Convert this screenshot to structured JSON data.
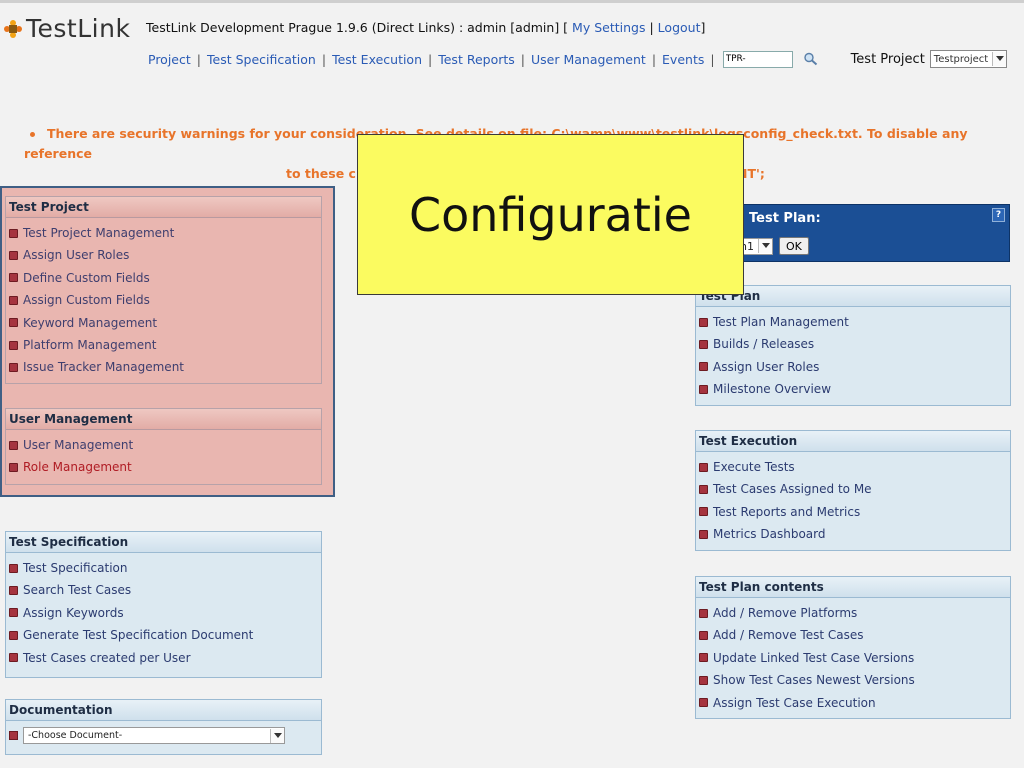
{
  "app": {
    "logo": "TestLink"
  },
  "header": {
    "title_prefix": "TestLink Development Prague 1.9.6 (Direct Links) : admin [admin] [",
    "my_settings": "My Settings",
    "sep": "|",
    "logout": "Logout",
    "title_suffix": "]"
  },
  "nav": {
    "items": [
      "Project",
      "Test Specification",
      "Test Execution",
      "Test Reports",
      "User Management",
      "Events"
    ],
    "search_value": "TPR-",
    "project_label": "Test Project",
    "project_selected": "Testproject"
  },
  "warning": {
    "line1": "There are security warnings for your consideration. See details on file: C:\\wamp\\www\\testlink\\logsconfig_check.txt. To disable any reference",
    "line2": "to these checks set $tlCfg->config_check_warning_mode = 'SILENT';"
  },
  "overlay": {
    "text": "Configuratie"
  },
  "left": {
    "test_project": {
      "title": "Test Project",
      "items": [
        "Test Project Management",
        "Assign User Roles",
        "Define Custom Fields",
        "Assign Custom Fields",
        "Keyword Management",
        "Platform Management",
        "Issue Tracker Management"
      ]
    },
    "user_management": {
      "title": "User Management",
      "items": [
        "User Management",
        "Role Management"
      ]
    },
    "test_specification": {
      "title": "Test Specification",
      "items": [
        "Test Specification",
        "Search Test Cases",
        "Assign Keywords",
        "Generate Test Specification Document",
        "Test Cases created per User"
      ]
    },
    "documentation": {
      "title": "Documentation",
      "select_value": "-Choose Document-"
    }
  },
  "right": {
    "plan_selector": {
      "label": "Test Plan:",
      "help": "?",
      "selected": "n1",
      "ok": "OK"
    },
    "test_plan": {
      "title": "Test Plan",
      "items": [
        "Test Plan Management",
        "Builds / Releases",
        "Assign User Roles",
        "Milestone Overview"
      ]
    },
    "test_execution": {
      "title": "Test Execution",
      "items": [
        "Execute Tests",
        "Test Cases Assigned to Me",
        "Test Reports and Metrics",
        "Metrics Dashboard"
      ]
    },
    "test_plan_contents": {
      "title": "Test Plan contents",
      "items": [
        "Add / Remove Platforms",
        "Add / Remove Test Cases",
        "Update Linked Test Case Versions",
        "Show Test Cases Newest Versions",
        "Assign Test Case Execution"
      ]
    }
  },
  "colors": {
    "warning": "#e8742a",
    "overlay": "#fbfb60",
    "plan_header": "#1b4f95",
    "admin_highlight": "#e9b6b0"
  }
}
